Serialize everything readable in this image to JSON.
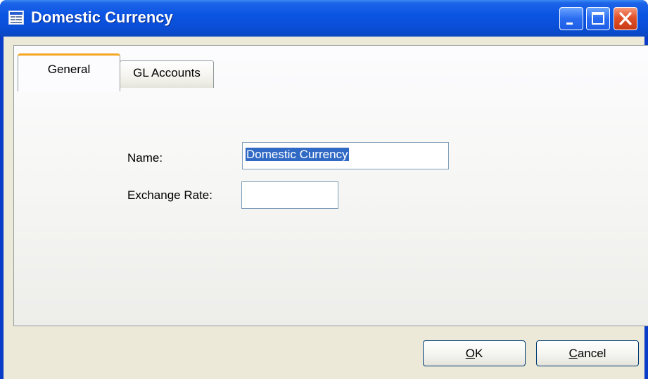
{
  "window": {
    "title": "Domestic Currency",
    "icon": "form-window-icon",
    "controls": [
      "minimize-icon",
      "maximize-icon",
      "close-icon"
    ]
  },
  "tabs": [
    {
      "label": "General",
      "active": true
    },
    {
      "label": "GL Accounts",
      "active": false
    }
  ],
  "form": {
    "name_label": "Name:",
    "name_value": "Domestic Currency",
    "rate_label": "Exchange Rate:",
    "rate_value": ""
  },
  "buttons": {
    "ok_accel": "O",
    "ok_rest": "K",
    "cancel_accel": "C",
    "cancel_rest": "ancel"
  },
  "colors": {
    "titlebar": "#0b55e3",
    "client": "#ece9d8",
    "active_tab_accent": "#f5a623",
    "selection": "#316ac5",
    "close_button": "#e2522a"
  }
}
